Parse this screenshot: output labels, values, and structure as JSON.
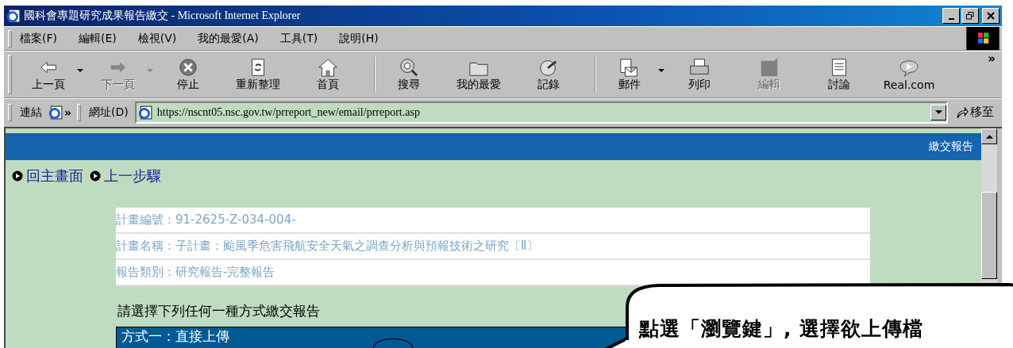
{
  "window": {
    "title": "國科會專題研究成果報告繳交 - Microsoft Internet Explorer"
  },
  "menu": [
    "檔案(F)",
    "編輯(E)",
    "檢視(V)",
    "我的最愛(A)",
    "工具(T)",
    "說明(H)"
  ],
  "toolbar": [
    [
      {
        "label": "上一頁",
        "disabled": false,
        "dropdown": true
      },
      {
        "label": "下一頁",
        "disabled": true,
        "dropdown": true
      },
      {
        "label": "停止",
        "disabled": false,
        "dropdown": false
      },
      {
        "label": "重新整理",
        "disabled": false,
        "dropdown": false
      },
      {
        "label": "首頁",
        "disabled": false,
        "dropdown": false
      }
    ],
    [
      {
        "label": "搜尋",
        "disabled": false,
        "dropdown": false
      },
      {
        "label": "我的最愛",
        "disabled": false,
        "dropdown": false
      },
      {
        "label": "記錄",
        "disabled": false,
        "dropdown": false
      }
    ],
    [
      {
        "label": "郵件",
        "disabled": false,
        "dropdown": true
      },
      {
        "label": "列印",
        "disabled": false,
        "dropdown": false
      },
      {
        "label": "編輯",
        "disabled": true,
        "dropdown": false
      },
      {
        "label": "討論",
        "disabled": false,
        "dropdown": false
      },
      {
        "label": "Real.com",
        "disabled": false,
        "dropdown": false
      }
    ]
  ],
  "toolbar_more": "»",
  "links_bar": {
    "label": "連結",
    "more": "»"
  },
  "address_bar": {
    "label": "網址(D)",
    "value": "https://nscnt05.nsc.gov.tw/prreport_new/email/prreport.asp",
    "go": "移至"
  },
  "page": {
    "header_title": "繳交報告",
    "nav_links": [
      "回主畫面",
      "上一步驟"
    ],
    "info_rows": [
      "計畫編號：91-2625-Z-034-004-",
      "計畫名稱：子計畫：颱風季危害飛航安全天氣之調查分析與預報技術之研究〔Ⅱ〕",
      "報告類別：研究報告-完整報告"
    ],
    "prompt": "請選擇下列任何一種方式繳交報告",
    "section_title": "方式一：直接上傳"
  },
  "callout": {
    "text": "點選「瀏覽鍵」, 選擇欲上傳檔"
  }
}
